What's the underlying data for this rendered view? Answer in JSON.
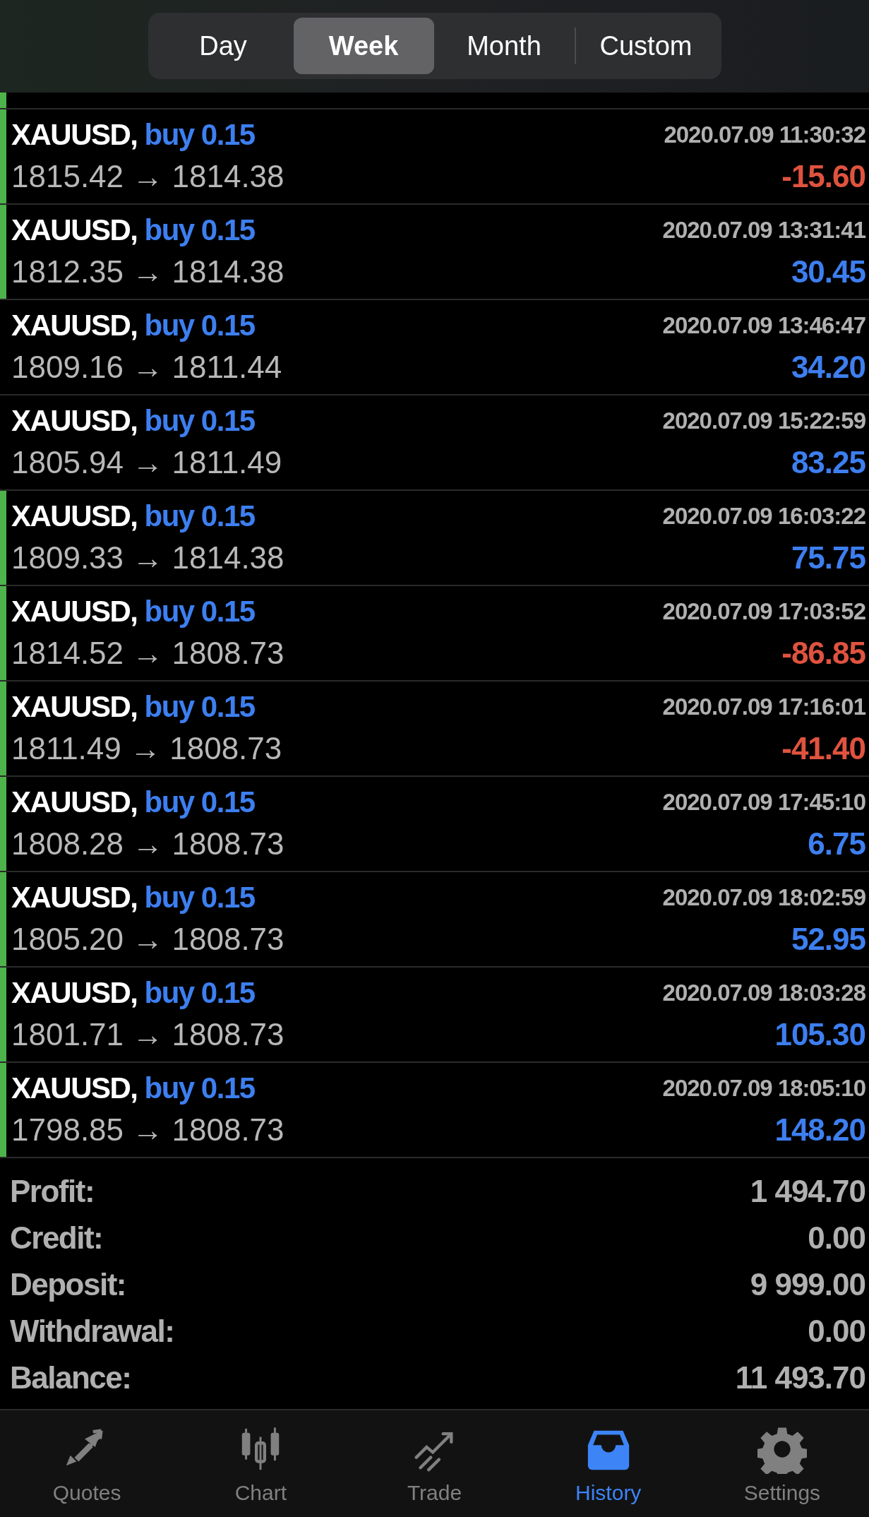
{
  "periods": [
    {
      "label": "Day",
      "selected": false
    },
    {
      "label": "Week",
      "selected": true
    },
    {
      "label": "Month",
      "selected": false
    },
    {
      "label": "Custom",
      "selected": false
    }
  ],
  "deals": [
    {
      "symbol": "XAUUSD,",
      "side": "buy 0.15",
      "prices": "1815.42 → 1814.38",
      "time": "2020.07.09 11:30:32",
      "profit": "-15.60",
      "color": "#e0533f",
      "marked": true
    },
    {
      "symbol": "XAUUSD,",
      "side": "buy 0.15",
      "prices": "1812.35 → 1814.38",
      "time": "2020.07.09 13:31:41",
      "profit": "30.45",
      "color": "#3d7ff0",
      "marked": true
    },
    {
      "symbol": "XAUUSD,",
      "side": "buy 0.15",
      "prices": "1809.16 → 1811.44",
      "time": "2020.07.09 13:46:47",
      "profit": "34.20",
      "color": "#3d7ff0",
      "marked": false
    },
    {
      "symbol": "XAUUSD,",
      "side": "buy 0.15",
      "prices": "1805.94 → 1811.49",
      "time": "2020.07.09 15:22:59",
      "profit": "83.25",
      "color": "#3d7ff0",
      "marked": false
    },
    {
      "symbol": "XAUUSD,",
      "side": "buy 0.15",
      "prices": "1809.33 → 1814.38",
      "time": "2020.07.09 16:03:22",
      "profit": "75.75",
      "color": "#3d7ff0",
      "marked": true
    },
    {
      "symbol": "XAUUSD,",
      "side": "buy 0.15",
      "prices": "1814.52 → 1808.73",
      "time": "2020.07.09 17:03:52",
      "profit": "-86.85",
      "color": "#e0533f",
      "marked": true
    },
    {
      "symbol": "XAUUSD,",
      "side": "buy 0.15",
      "prices": "1811.49 → 1808.73",
      "time": "2020.07.09 17:16:01",
      "profit": "-41.40",
      "color": "#e0533f",
      "marked": true
    },
    {
      "symbol": "XAUUSD,",
      "side": "buy 0.15",
      "prices": "1808.28 → 1808.73",
      "time": "2020.07.09 17:45:10",
      "profit": "6.75",
      "color": "#3d7ff0",
      "marked": true
    },
    {
      "symbol": "XAUUSD,",
      "side": "buy 0.15",
      "prices": "1805.20 → 1808.73",
      "time": "2020.07.09 18:02:59",
      "profit": "52.95",
      "color": "#3d7ff0",
      "marked": true
    },
    {
      "symbol": "XAUUSD,",
      "side": "buy 0.15",
      "prices": "1801.71 → 1808.73",
      "time": "2020.07.09 18:03:28",
      "profit": "105.30",
      "color": "#3d7ff0",
      "marked": true
    },
    {
      "symbol": "XAUUSD,",
      "side": "buy 0.15",
      "prices": "1798.85 → 1808.73",
      "time": "2020.07.09 18:05:10",
      "profit": "148.20",
      "color": "#3d7ff0",
      "marked": true
    }
  ],
  "summary": [
    {
      "label": "Profit:",
      "value": "1 494.70"
    },
    {
      "label": "Credit:",
      "value": "0.00"
    },
    {
      "label": "Deposit:",
      "value": "9 999.00"
    },
    {
      "label": "Withdrawal:",
      "value": "0.00"
    },
    {
      "label": "Balance:",
      "value": "11 493.70"
    }
  ],
  "tabs": [
    {
      "label": "Quotes",
      "kind": "quotes",
      "selected": false
    },
    {
      "label": "Chart",
      "kind": "chart",
      "selected": false
    },
    {
      "label": "Trade",
      "kind": "trade",
      "selected": false
    },
    {
      "label": "History",
      "kind": "history",
      "selected": true
    },
    {
      "label": "Settings",
      "kind": "settings",
      "selected": false
    }
  ]
}
